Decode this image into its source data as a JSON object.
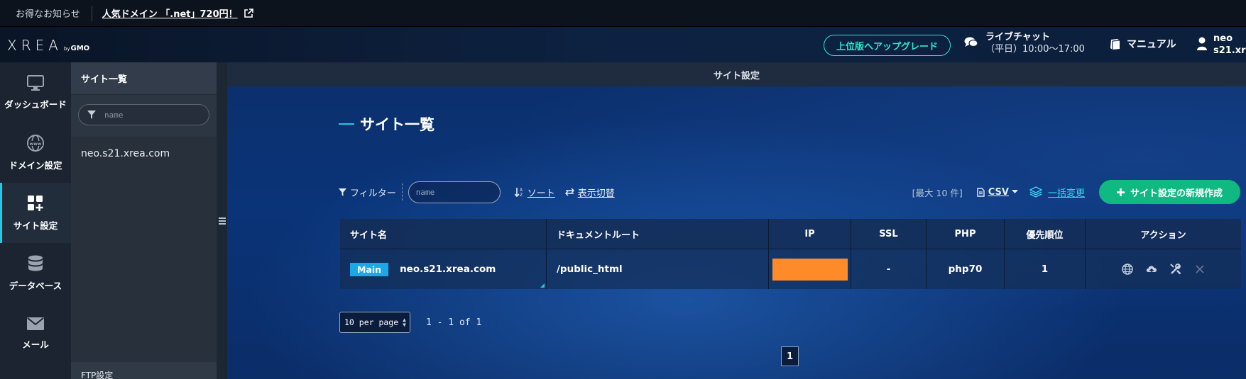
{
  "topbar": {
    "notice": "お得なお知らせ",
    "promo": "人気ドメイン 「.net」720円！"
  },
  "header": {
    "logo_text": "XREA",
    "logo_by": "by",
    "logo_gmo": "GMO",
    "upgrade_label": "上位版へアップグレード",
    "livechat_title": "ライブチャット",
    "livechat_hours": "（平日）10:00〜17:00",
    "manual_label": "マニュアル",
    "user_line1": "neo",
    "user_line2": "s21.xr"
  },
  "leftnav": {
    "items": [
      {
        "label": "ダッシュボード",
        "icon": "monitor-icon"
      },
      {
        "label": "ドメイン設定",
        "icon": "globe-www-icon"
      },
      {
        "label": "サイト設定",
        "icon": "grid-plus-icon",
        "active": true
      },
      {
        "label": "データベース",
        "icon": "database-icon"
      },
      {
        "label": "メール",
        "icon": "envelope-icon"
      }
    ]
  },
  "sidebar": {
    "title": "サイト一覧",
    "filter_placeholder": "name",
    "sites": [
      "neo.s21.xrea.com"
    ],
    "bottom_label": "FTP設定"
  },
  "main": {
    "page_header": "サイト設定",
    "title": "サイト一覧",
    "toolbar": {
      "filter_label": "フィルター",
      "filter_placeholder": "name",
      "sort_label": "ソート",
      "display_toggle_label": "表示切替",
      "max_label": "[最大 10 件]",
      "csv_label": "CSV",
      "bulk_label": "一括変更",
      "new_label": "サイト設定の新規作成"
    },
    "table": {
      "headers": [
        "サイト名",
        "ドキュメントルート",
        "IP",
        "SSL",
        "PHP",
        "優先順位",
        "アクション"
      ],
      "rows": [
        {
          "badge": "Main",
          "site": "neo.s21.xrea.com",
          "docroot": "/public_html",
          "ip": "",
          "ssl": "-",
          "php": "php70",
          "priority": "1"
        }
      ]
    },
    "pagination": {
      "per_page": "10 per page",
      "range": "1 - 1 of 1",
      "current_page": "1"
    }
  },
  "colors": {
    "accent_cyan": "#22c7e8",
    "upgrade_teal": "#2ee6d0",
    "new_button_green": "#10b981",
    "badge_blue": "#1aa9e8",
    "ip_redaction_orange": "#ff8a2a"
  }
}
